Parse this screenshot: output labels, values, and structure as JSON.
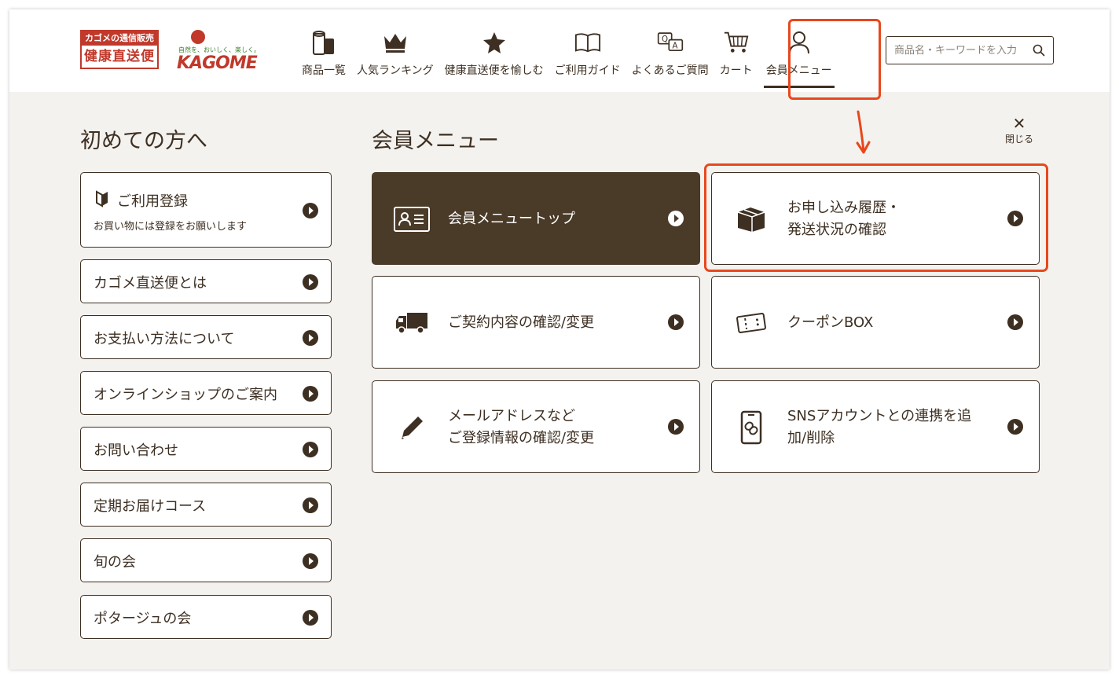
{
  "header": {
    "logo_top": "カゴメの通信販売",
    "logo_bottom": "健康直送便",
    "kagome_tagline": "自然を、おいしく、楽しく。",
    "kagome_brand": "KAGOME",
    "nav": [
      {
        "label": "商品一覧",
        "icon": "products-icon"
      },
      {
        "label": "人気ランキング",
        "icon": "crown-icon"
      },
      {
        "label": "健康直送便を愉しむ",
        "icon": "star-icon"
      },
      {
        "label": "ご利用ガイド",
        "icon": "book-icon"
      },
      {
        "label": "よくあるご質問",
        "icon": "qa-icon"
      },
      {
        "label": "カート",
        "icon": "cart-icon"
      },
      {
        "label": "会員メニュー",
        "icon": "user-icon"
      }
    ],
    "search_placeholder": "商品名・キーワードを入力"
  },
  "left": {
    "title": "初めての方へ",
    "items": [
      {
        "label": "ご利用登録",
        "sub": "お買い物には登録をお願いします"
      },
      {
        "label": "カゴメ直送便とは"
      },
      {
        "label": "お支払い方法について"
      },
      {
        "label": "オンラインショップのご案内"
      },
      {
        "label": "お問い合わせ"
      },
      {
        "label": "定期お届けコース"
      },
      {
        "label": "旬の会"
      },
      {
        "label": "ポタージュの会"
      }
    ]
  },
  "right": {
    "title": "会員メニュー",
    "close_label": "閉じる",
    "cards": [
      {
        "line1": "会員メニュートップ",
        "line2": "",
        "icon": "member-card-icon"
      },
      {
        "line1": "お申し込み履歴・",
        "line2": "発送状況の確認",
        "icon": "box-icon"
      },
      {
        "line1": "ご契約内容の確認/変更",
        "line2": "",
        "icon": "truck-icon"
      },
      {
        "line1": "クーポンBOX",
        "line2": "",
        "icon": "coupon-icon"
      },
      {
        "line1": "メールアドレスなど",
        "line2": "ご登録情報の確認/変更",
        "icon": "pencil-icon"
      },
      {
        "line1": "SNSアカウントとの連携を追",
        "line2": "加/削除",
        "icon": "phone-link-icon"
      }
    ]
  },
  "colors": {
    "brown": "#3d2f22",
    "dark_card": "#4a3a28",
    "highlight": "#e8471c",
    "brand_red": "#c0392b",
    "background": "#f4f2ee"
  }
}
